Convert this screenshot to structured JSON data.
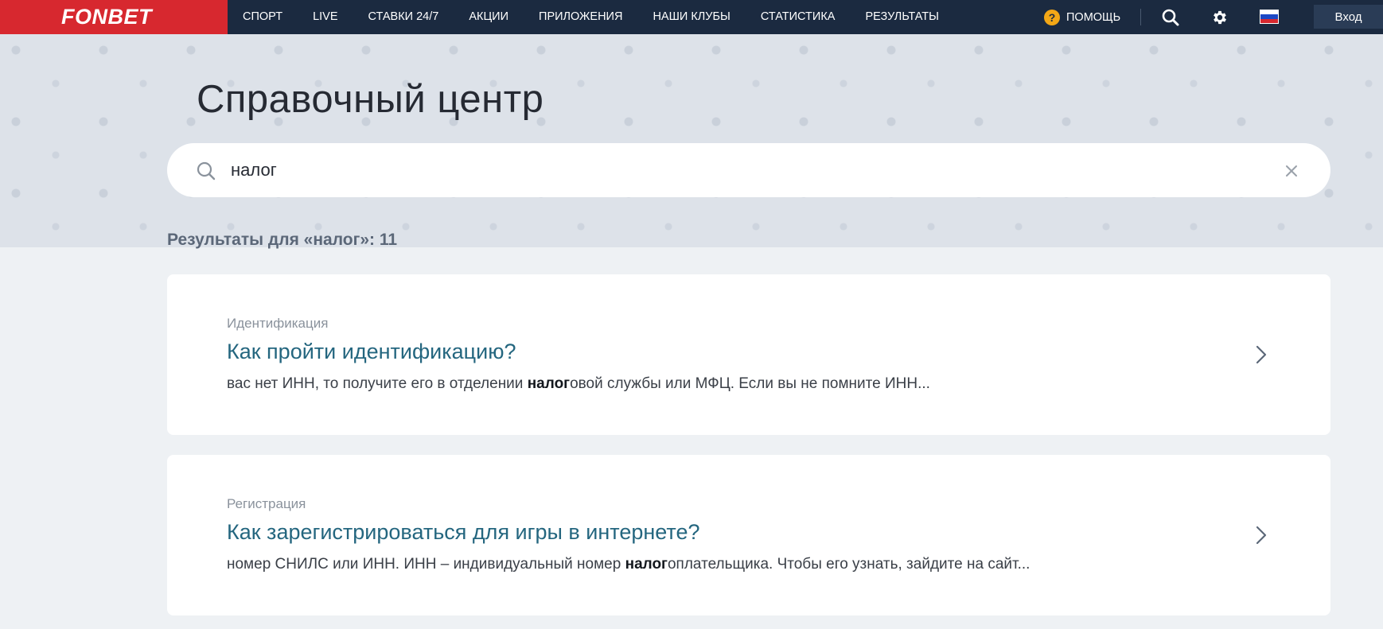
{
  "header": {
    "logo": "FONBET",
    "nav": [
      "СПОРТ",
      "LIVE",
      "СТАВКИ 24/7",
      "АКЦИИ",
      "ПРИЛОЖЕНИЯ",
      "НАШИ КЛУБЫ",
      "СТАТИСТИКА",
      "РЕЗУЛЬТАТЫ"
    ],
    "help_icon": "?",
    "help_label": "ПОМОЩЬ",
    "search_icon": "search-icon",
    "settings_icon": "gear-icon",
    "language_flag": "russian-flag-icon",
    "login_label": "Вход"
  },
  "hero": {
    "title": "Справочный центр",
    "search": {
      "value": "налог",
      "placeholder": ""
    }
  },
  "results": {
    "count_label": "Результаты для «налог»: 11",
    "items": [
      {
        "category": "Идентификация",
        "title": "Как пройти идентификацию?",
        "snippet_before": "вас нет ИНН, то получите его в отделении ",
        "snippet_match": "налог",
        "snippet_after": "овой службы или МФЦ. Если вы не помните ИНН..."
      },
      {
        "category": "Регистрация",
        "title": "Как зарегистрироваться для игры в интернете?",
        "snippet_before": "номер СНИЛС или ИНН. ИНН – индивидуальный номер ",
        "snippet_match": "налог",
        "snippet_after": "оплательщика. Чтобы его узнать, зайдите на сайт..."
      }
    ]
  },
  "colors": {
    "brand_red": "#d7282f",
    "nav_bg": "#1b2a40",
    "link_blue": "#24667f"
  }
}
